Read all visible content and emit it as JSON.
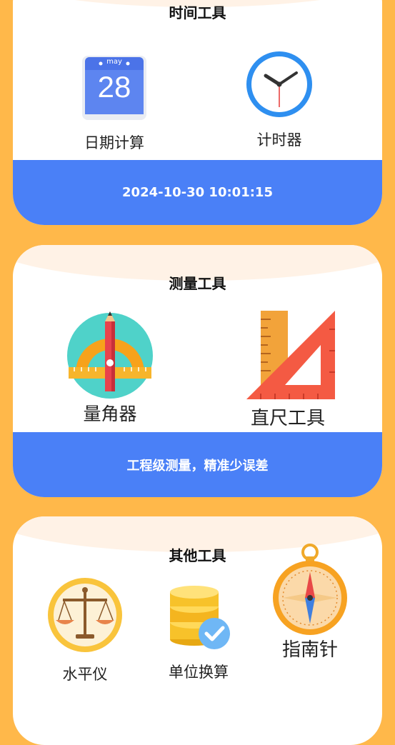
{
  "time_tools": {
    "title": "时间工具",
    "calendar_month": "may",
    "calendar_day": "28",
    "date_calc_label": "日期计算",
    "timer_label": "计时器",
    "datetime": "2024-10-30 10:01:15"
  },
  "measure_tools": {
    "title": "测量工具",
    "protractor_label": "量角器",
    "ruler_label": "直尺工具",
    "slogan": "工程级测量，精准少误差"
  },
  "other_tools": {
    "title": "其他工具",
    "level_label": "水平仪",
    "unit_conv_label": "单位换算",
    "compass_label": "指南针"
  },
  "colors": {
    "background": "#FFB84A",
    "accent_blue": "#4A80F7"
  }
}
